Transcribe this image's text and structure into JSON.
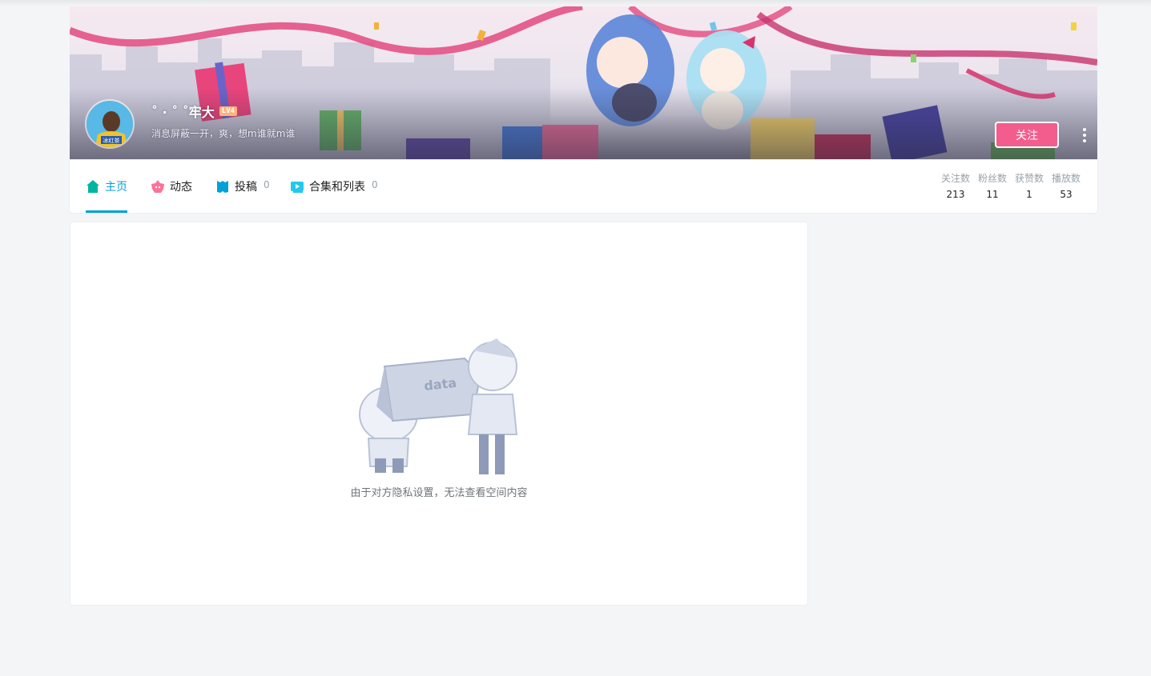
{
  "user": {
    "name": "˚ · ˚ ˚牢大",
    "level": "LV4",
    "sign": "消息屏蔽一开，爽，想m谁就m谁",
    "avatar_text": "冰红茶"
  },
  "actions": {
    "follow_label": "关注"
  },
  "tabs": [
    {
      "label": "主页",
      "count": "",
      "icon": "home-icon"
    },
    {
      "label": "动态",
      "count": "",
      "icon": "dynamic-icon"
    },
    {
      "label": "投稿",
      "count": "0",
      "icon": "upload-icon"
    },
    {
      "label": "合集和列表",
      "count": "0",
      "icon": "collection-icon"
    }
  ],
  "stats": [
    {
      "label": "关注数",
      "value": "213"
    },
    {
      "label": "粉丝数",
      "value": "11"
    },
    {
      "label": "获赞数",
      "value": "1"
    },
    {
      "label": "播放数",
      "value": "53"
    }
  ],
  "empty": {
    "box_label": "data",
    "message": "由于对方隐私设置，无法查看空间内容"
  },
  "colors": {
    "accent": "#00a1d6",
    "follow": "#f25d8e",
    "home_icon": "#00b5a0",
    "dynamic_icon": "#fb7299",
    "upload_icon": "#00a1d6",
    "collection_icon": "#23c9ed"
  }
}
